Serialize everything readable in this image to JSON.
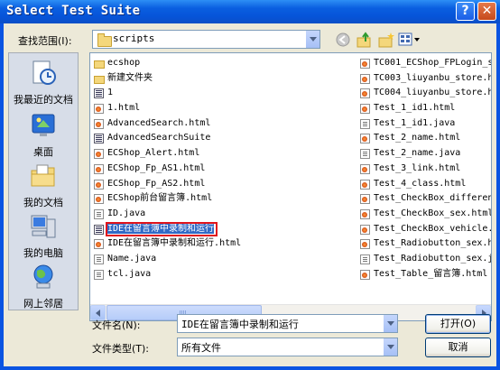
{
  "window": {
    "title": "Select Test Suite",
    "help_symbol": "?",
    "close_symbol": "✕"
  },
  "lookin": {
    "label": "查找范围(I):",
    "value": "scripts"
  },
  "places": [
    {
      "label": "我最近的文档",
      "icon": "recent-documents-icon"
    },
    {
      "label": "桌面",
      "icon": "desktop-icon"
    },
    {
      "label": "我的文档",
      "icon": "my-documents-icon"
    },
    {
      "label": "我的电脑",
      "icon": "my-computer-icon"
    },
    {
      "label": "网上邻居",
      "icon": "network-places-icon"
    }
  ],
  "files": {
    "col1": [
      {
        "name": "ecshop",
        "type": "folder"
      },
      {
        "name": "新建文件夹",
        "type": "folder"
      },
      {
        "name": "1",
        "type": "suite"
      },
      {
        "name": "1.html",
        "type": "html"
      },
      {
        "name": "AdvancedSearch.html",
        "type": "html"
      },
      {
        "name": "AdvancedSearchSuite",
        "type": "suite"
      },
      {
        "name": "ECShop_Alert.html",
        "type": "html"
      },
      {
        "name": "ECShop_Fp_AS1.html",
        "type": "html"
      },
      {
        "name": "ECShop_Fp_AS2.html",
        "type": "html"
      },
      {
        "name": "ECShop前台留言簿.html",
        "type": "html"
      },
      {
        "name": "ID.java",
        "type": "java"
      },
      {
        "name": "IDE在留言簿中录制和运行",
        "type": "suite",
        "selected": true
      },
      {
        "name": "IDE在留言簿中录制和运行.html",
        "type": "html"
      },
      {
        "name": "Name.java",
        "type": "java"
      },
      {
        "name": "tcl.java",
        "type": "java"
      }
    ],
    "col2": [
      {
        "name": "TC001_ECShop_FPLogin_s",
        "type": "html"
      },
      {
        "name": "TC003_liuyanbu_store.h",
        "type": "html"
      },
      {
        "name": "TC004_liuyanbu_store.h",
        "type": "html"
      },
      {
        "name": "Test_1_id1.html",
        "type": "html"
      },
      {
        "name": "Test_1_id1.java",
        "type": "java"
      },
      {
        "name": "Test_2_name.html",
        "type": "html"
      },
      {
        "name": "Test_2_name.java",
        "type": "java"
      },
      {
        "name": "Test_3_link.html",
        "type": "html"
      },
      {
        "name": "Test_4_class.html",
        "type": "html"
      },
      {
        "name": "Test_CheckBox_differen",
        "type": "html"
      },
      {
        "name": "Test_CheckBox_sex.html",
        "type": "html"
      },
      {
        "name": "Test_CheckBox_vehicle.",
        "type": "html"
      },
      {
        "name": "Test_Radiobutton_sex.h",
        "type": "html"
      },
      {
        "name": "Test_Radiobutton_sex.j",
        "type": "java"
      },
      {
        "name": "Test_Table_留言簿.html",
        "type": "html"
      }
    ]
  },
  "filename": {
    "label": "文件名(N):",
    "value": "IDE在留言簿中录制和运行"
  },
  "filetype": {
    "label": "文件类型(T):",
    "value": "所有文件"
  },
  "buttons": {
    "open": "打开(O)",
    "cancel": "取消"
  }
}
